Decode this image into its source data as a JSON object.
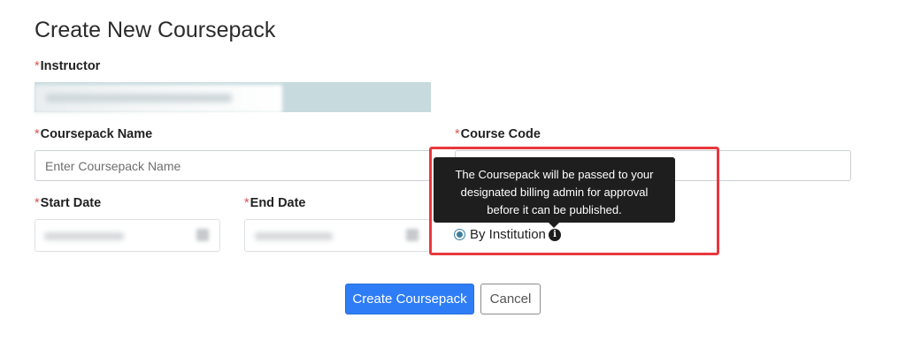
{
  "page": {
    "title": "Create New Coursepack"
  },
  "form": {
    "required_mark": "*",
    "instructor": {
      "label": "Instructor"
    },
    "coursepack_name": {
      "label": "Coursepack Name",
      "placeholder": "Enter Coursepack Name",
      "value": ""
    },
    "course_code": {
      "label": "Course Code"
    },
    "start_date": {
      "label": "Start Date"
    },
    "end_date": {
      "label": "End Date"
    },
    "payment": {
      "option_label": "By Institution",
      "selected": true
    }
  },
  "tooltip": {
    "text": "The Coursepack will be passed to your designated billing admin for approval before it can be published."
  },
  "buttons": {
    "create": "Create Coursepack",
    "cancel": "Cancel"
  },
  "icons": {
    "info": "info-icon",
    "calendar": "calendar-icon"
  },
  "colors": {
    "primary": "#2f7df6",
    "required": "#d9534f",
    "highlight": "#e8383d",
    "tooltip_bg": "#1e1e1e",
    "instructor_bar": "#c7dade"
  }
}
